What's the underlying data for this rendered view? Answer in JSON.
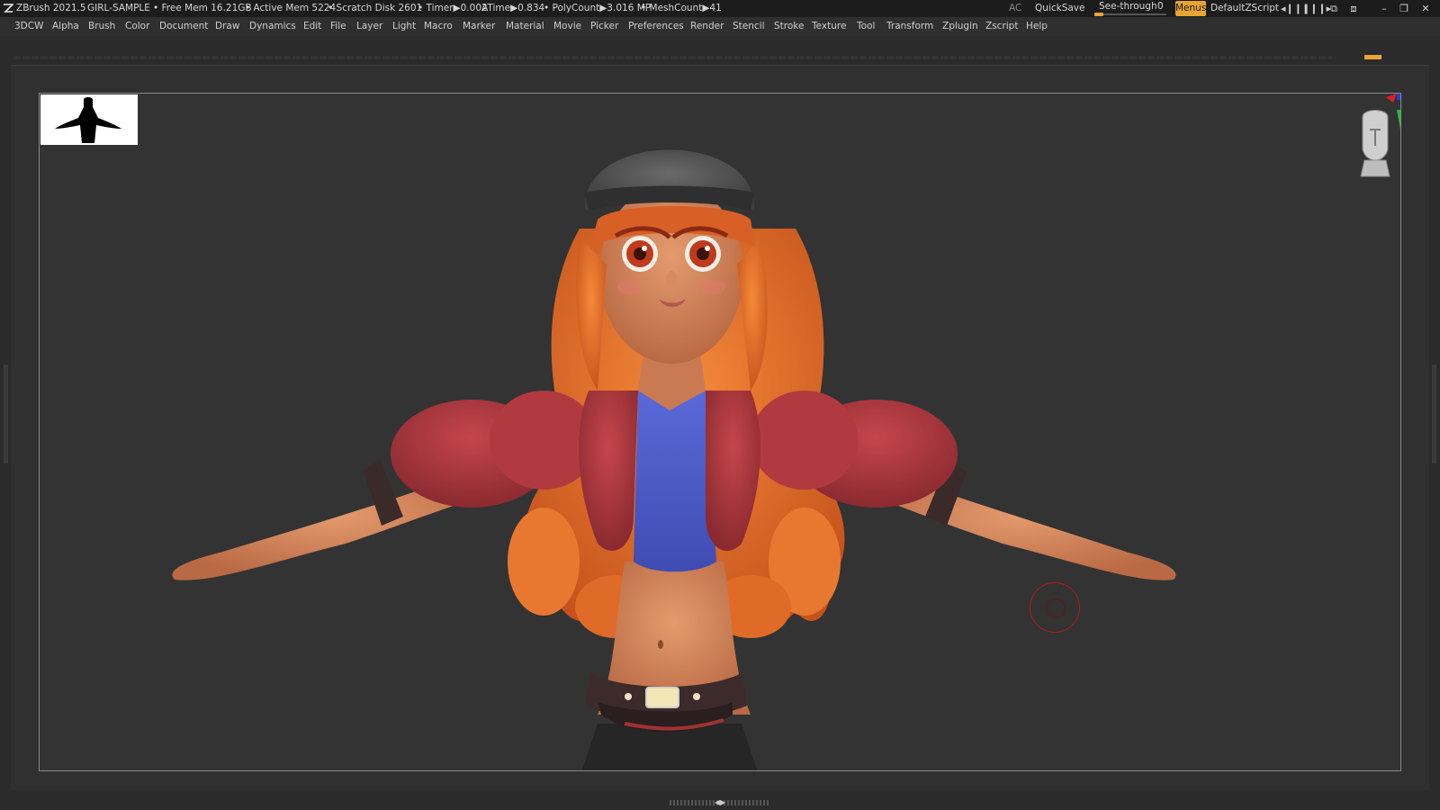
{
  "app": {
    "name": "ZBrush 2021.5",
    "document": "GIRL-SAMPLE"
  },
  "status": {
    "free_mem": "• Free Mem 16.21GB",
    "active_mem": "• Active Mem 5224",
    "scratch_disk": "• Scratch Disk 2601",
    "timer": "• Timer▶0.002",
    "atime": "ATime▶0.834",
    "polycount": "• PolyCount▶3.016 MP",
    "meshcount": "• MeshCount▶41"
  },
  "title_controls": {
    "ac": "AC",
    "quicksave": "QuickSave",
    "seethrough_label": "See-through",
    "seethrough_value": "0",
    "seethrough_level": 0,
    "menus": "Menus",
    "zscript": "DefaultZScript"
  },
  "menu": [
    "3DCW",
    "Alpha",
    "Brush",
    "Color",
    "Document",
    "Draw",
    "Dynamics",
    "Edit",
    "File",
    "Layer",
    "Light",
    "Macro",
    "Marker",
    "Material",
    "Movie",
    "Picker",
    "Preferences",
    "Render",
    "Stencil",
    "Stroke",
    "Texture",
    "Tool",
    "Transform",
    "Zplugin",
    "Zscript",
    "Help"
  ],
  "colors": {
    "accent": "#e8a532",
    "canvas": "#333333",
    "brush_cursor": "#b31b1b"
  },
  "icons": {
    "logo": "zbrush-logo-icon",
    "minimize": "minimize-icon",
    "restore": "restore-icon",
    "close": "close-icon"
  }
}
